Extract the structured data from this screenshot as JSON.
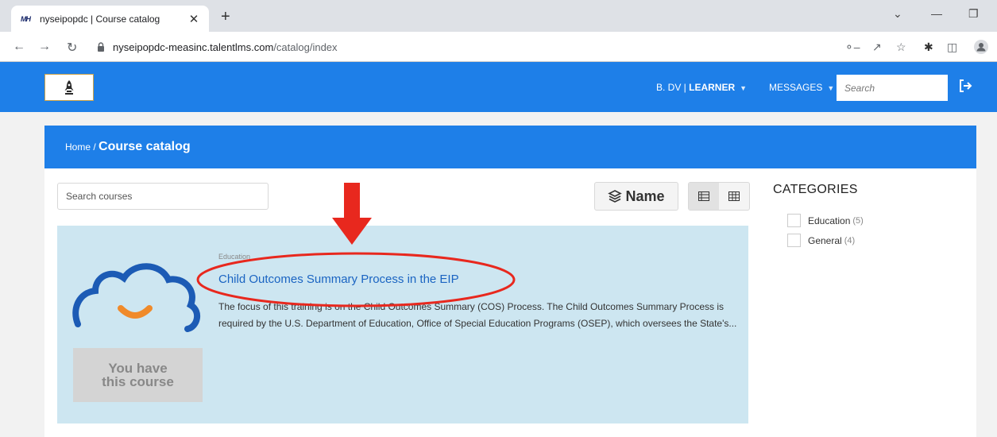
{
  "browser": {
    "tab_favicon": "MH",
    "tab_title": "nyseipopdc | Course catalog",
    "tab_close": "✕",
    "new_tab": "+",
    "url_host": "nyseipopdc-measinc.talentlms.com",
    "url_path": "/catalog/index",
    "icons": [
      "back-icon",
      "forward-icon",
      "reload-icon",
      "lock-icon",
      "key-icon",
      "share-icon",
      "star-icon",
      "extensions-icon",
      "side-panel-icon",
      "profile-icon"
    ]
  },
  "header": {
    "user_label": "B. DV",
    "role_label": "LEARNER",
    "messages_label": "MESSAGES",
    "search_placeholder": "Search",
    "brand_color": "#1e7fe8"
  },
  "breadcrumb": {
    "home": "Home",
    "separator": "/",
    "current": "Course catalog"
  },
  "toolbar": {
    "search_placeholder": "Search courses",
    "sort_label": "Name"
  },
  "categories": {
    "title": "CATEGORIES",
    "items": [
      {
        "label": "Education",
        "count": "(5)"
      },
      {
        "label": "General",
        "count": "(4)"
      }
    ]
  },
  "course": {
    "category": "Education",
    "title": "Child Outcomes Summary Process in the EIP",
    "description": "The focus of this training is on the Child Outcomes Summary (COS) Process. The Child Outcomes Summary Process is required by the U.S. Department of Education, Office of Special Education Programs (OSEP), which oversees the State's...",
    "badge_line1": "You have",
    "badge_line2": "this course",
    "card_color": "#cde6f1"
  },
  "annotation": {
    "color": "#e8281e"
  }
}
